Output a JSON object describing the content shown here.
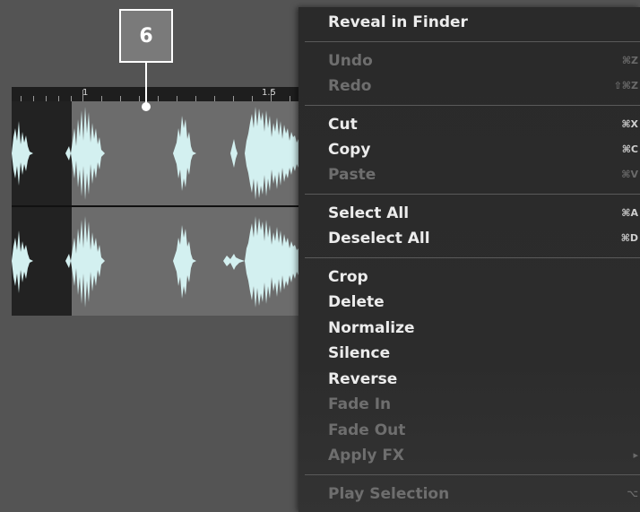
{
  "callout": {
    "number": "6"
  },
  "ruler": {
    "labels": [
      "1",
      "1.5"
    ]
  },
  "menu": {
    "reveal": {
      "label": "Reveal in Finder"
    },
    "undo": {
      "label": "Undo",
      "shortcut": "⌘Z",
      "disabled": true
    },
    "redo": {
      "label": "Redo",
      "shortcut": "⇧⌘Z",
      "disabled": true
    },
    "cut": {
      "label": "Cut",
      "shortcut": "⌘X"
    },
    "copy": {
      "label": "Copy",
      "shortcut": "⌘C"
    },
    "paste": {
      "label": "Paste",
      "shortcut": "⌘V",
      "disabled": true
    },
    "select_all": {
      "label": "Select All",
      "shortcut": "⌘A"
    },
    "deselect_all": {
      "label": "Deselect All",
      "shortcut": "⌘D"
    },
    "crop": {
      "label": "Crop"
    },
    "delete": {
      "label": "Delete"
    },
    "normalize": {
      "label": "Normalize"
    },
    "silence": {
      "label": "Silence"
    },
    "reverse": {
      "label": "Reverse"
    },
    "fade_in": {
      "label": "Fade In",
      "disabled": true
    },
    "fade_out": {
      "label": "Fade Out",
      "disabled": true
    },
    "apply_fx": {
      "label": "Apply FX",
      "disabled": true
    },
    "play_selection": {
      "label": "Play Selection",
      "shortcut": "⌥",
      "disabled": true
    }
  },
  "colors": {
    "background": "#545454",
    "waveform": "#d3f0f0",
    "selection": "#6c6c6c",
    "menu": "#2a2a2a"
  }
}
